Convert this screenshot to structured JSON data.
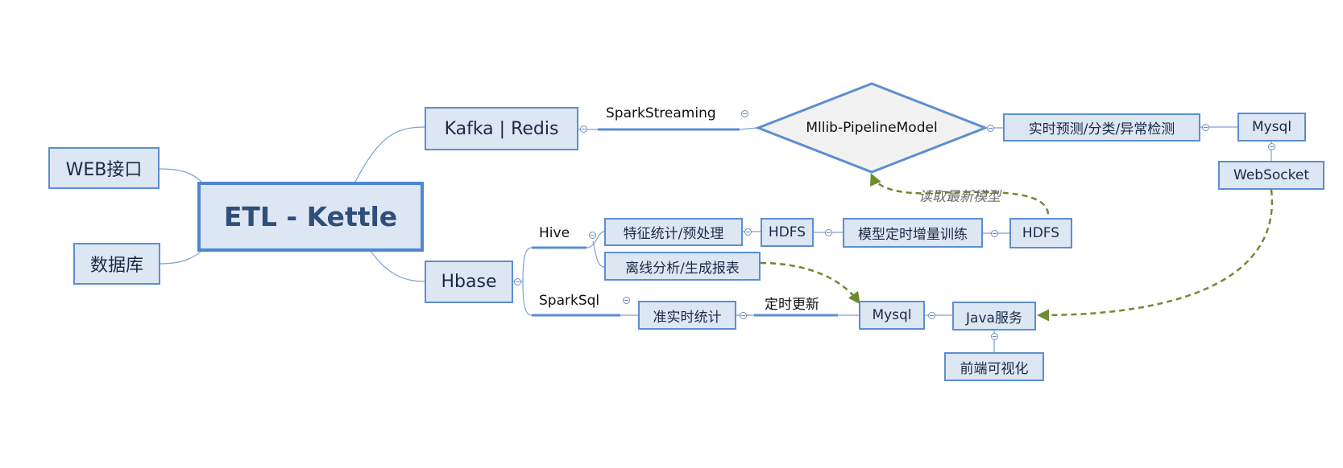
{
  "root": {
    "label": "ETL - Kettle"
  },
  "sources": {
    "web": "WEB接口",
    "db": "数据库"
  },
  "branches": {
    "kafka": "Kafka | Redis",
    "hbase": "Hbase"
  },
  "stream": {
    "edge_label": "SparkStreaming",
    "model": "Mllib-PipelineModel",
    "realtime": "实时预测/分类/异常检测",
    "mysql": "Mysql",
    "websocket": "WebSocket"
  },
  "hive": {
    "label": "Hive",
    "feature": "特征统计/预处理",
    "hdfs1": "HDFS",
    "train": "模型定时增量训练",
    "hdfs2": "HDFS",
    "offline": "离线分析/生成报表"
  },
  "sparksql": {
    "label": "SparkSql",
    "nearrt": "准实时统计",
    "edge_label": "定时更新",
    "mysql": "Mysql",
    "java": "Java服务",
    "frontend": "前端可视化"
  },
  "annotations": {
    "read_model": "读取最新模型"
  },
  "colors": {
    "node_border": "#5b8fd0",
    "node_fill": "#dde6f3",
    "line": "#5b8fd0",
    "dashed_arrow": "#6d8b30",
    "diamond_fill": "#f2f2f2"
  }
}
